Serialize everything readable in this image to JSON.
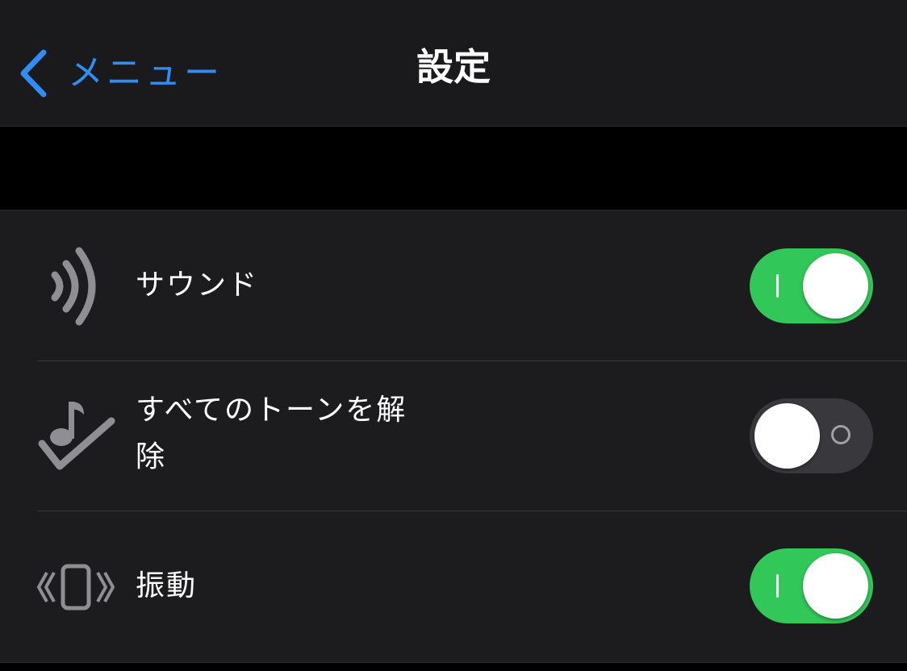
{
  "navbar": {
    "back_label": "メニュー",
    "title": "設定"
  },
  "settings": [
    {
      "label": "サウンド",
      "icon": "sound-waves-icon",
      "enabled": true
    },
    {
      "label_line1": "すべてのトーンを解",
      "label_line2": "除",
      "icon": "music-note-checkmark-icon",
      "enabled": false
    },
    {
      "label": "振動",
      "icon": "vibration-icon",
      "enabled": true
    }
  ],
  "colors": {
    "accent": "#2f8ef5",
    "toggle_on": "#32c759",
    "toggle_off": "#39393d",
    "background": "#000000",
    "cell_background": "#1c1c1e"
  }
}
